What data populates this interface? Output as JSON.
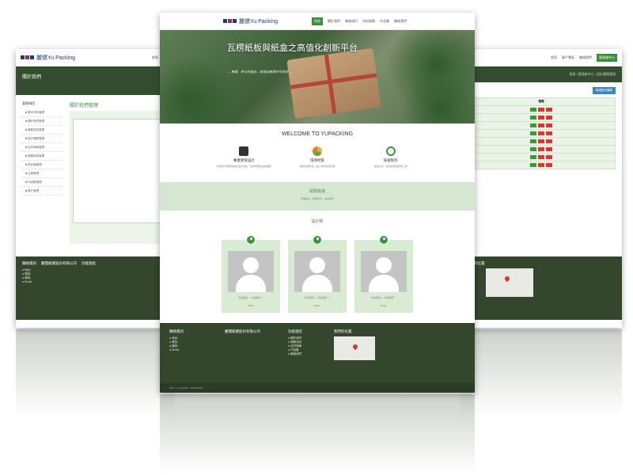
{
  "left": {
    "logo": "麗儒Yu Packing",
    "nav": [
      "首頁",
      "關於"
    ],
    "header_title": "關於我們",
    "side_title": "管理項目",
    "side_items": [
      "■ 基本資料管理",
      "■ 關於我們管理",
      "■ 服務項目管理",
      "■ 設計團隊管理",
      "■ 包材清單管理",
      "■ 相關商品管理",
      "■ 設計師管理",
      "■ 主題管理",
      "■ 作品集管理",
      "■ 客戶管理"
    ],
    "main_title": "關於我們管理",
    "footer_heads": [
      "聯絡資訊",
      "麗儒紙業股份有限公司",
      "功能連結"
    ],
    "footer_lines": [
      "● 地址：",
      "● 電話：",
      "● 傳真：",
      "● Email："
    ],
    "copyright": "2017 © Copyright. YUPACKING"
  },
  "center": {
    "logo": "麗儒Yu Packing",
    "nav": [
      "首頁",
      "關於我們",
      "服務項目",
      "包材清單",
      "作品集",
      "聯絡我們"
    ],
    "hero_title": "瓦楞紙板與紙盒之高值化創新平台",
    "hero_sub": "— 專業、多元的產品、創造出無限的可能性 —",
    "welcome": "WELCOME TO YUPACKING",
    "features": [
      {
        "title": "專業客製設計",
        "desc": "依照客戶需求客製化設計包裝，提供專業建議與服務"
      },
      {
        "title": "環保材質",
        "desc": "使用環保材質，減少對環境的影響"
      },
      {
        "title": "快速製作",
        "desc": "快速交貨，讓您的產品即時上市"
      }
    ],
    "band_title": "經營有成",
    "band_sub": "專業設計、環保材質、快速製作",
    "designers_title": "設計師",
    "designer_meta": "作品數量  ☆  作品數量  ☆",
    "designer_link": "Enter",
    "footer_heads": [
      "聯絡資訊",
      "麗儒紙業股份有限公司",
      "功能連結",
      "我們的位置"
    ],
    "footer_lines": [
      "● 地址：",
      "● 電話：",
      "● 傳真：",
      "● Email："
    ],
    "footer_links": [
      "● 關於我們",
      "● 服務項目",
      "● 包材清單",
      "● 作品集",
      "● 聯絡我們"
    ],
    "copyright": "2017 © Copyright. YUPACKING"
  },
  "right": {
    "nav": [
      "首頁",
      "客戶專區",
      "聯絡我們",
      "管理者中心"
    ],
    "breadcrumb": "首頁 / 管理者中心 / 設計團隊管理",
    "add_button": "新增設計團隊",
    "table_head": "管理",
    "rows": 8,
    "footer_head": "我們的位置"
  },
  "colors": {
    "dark_green": "#344d2f",
    "accent_green": "#3a9a3a",
    "light_green": "#d8ecd4",
    "red": "#dd3333",
    "blue": "#3b85c6"
  }
}
